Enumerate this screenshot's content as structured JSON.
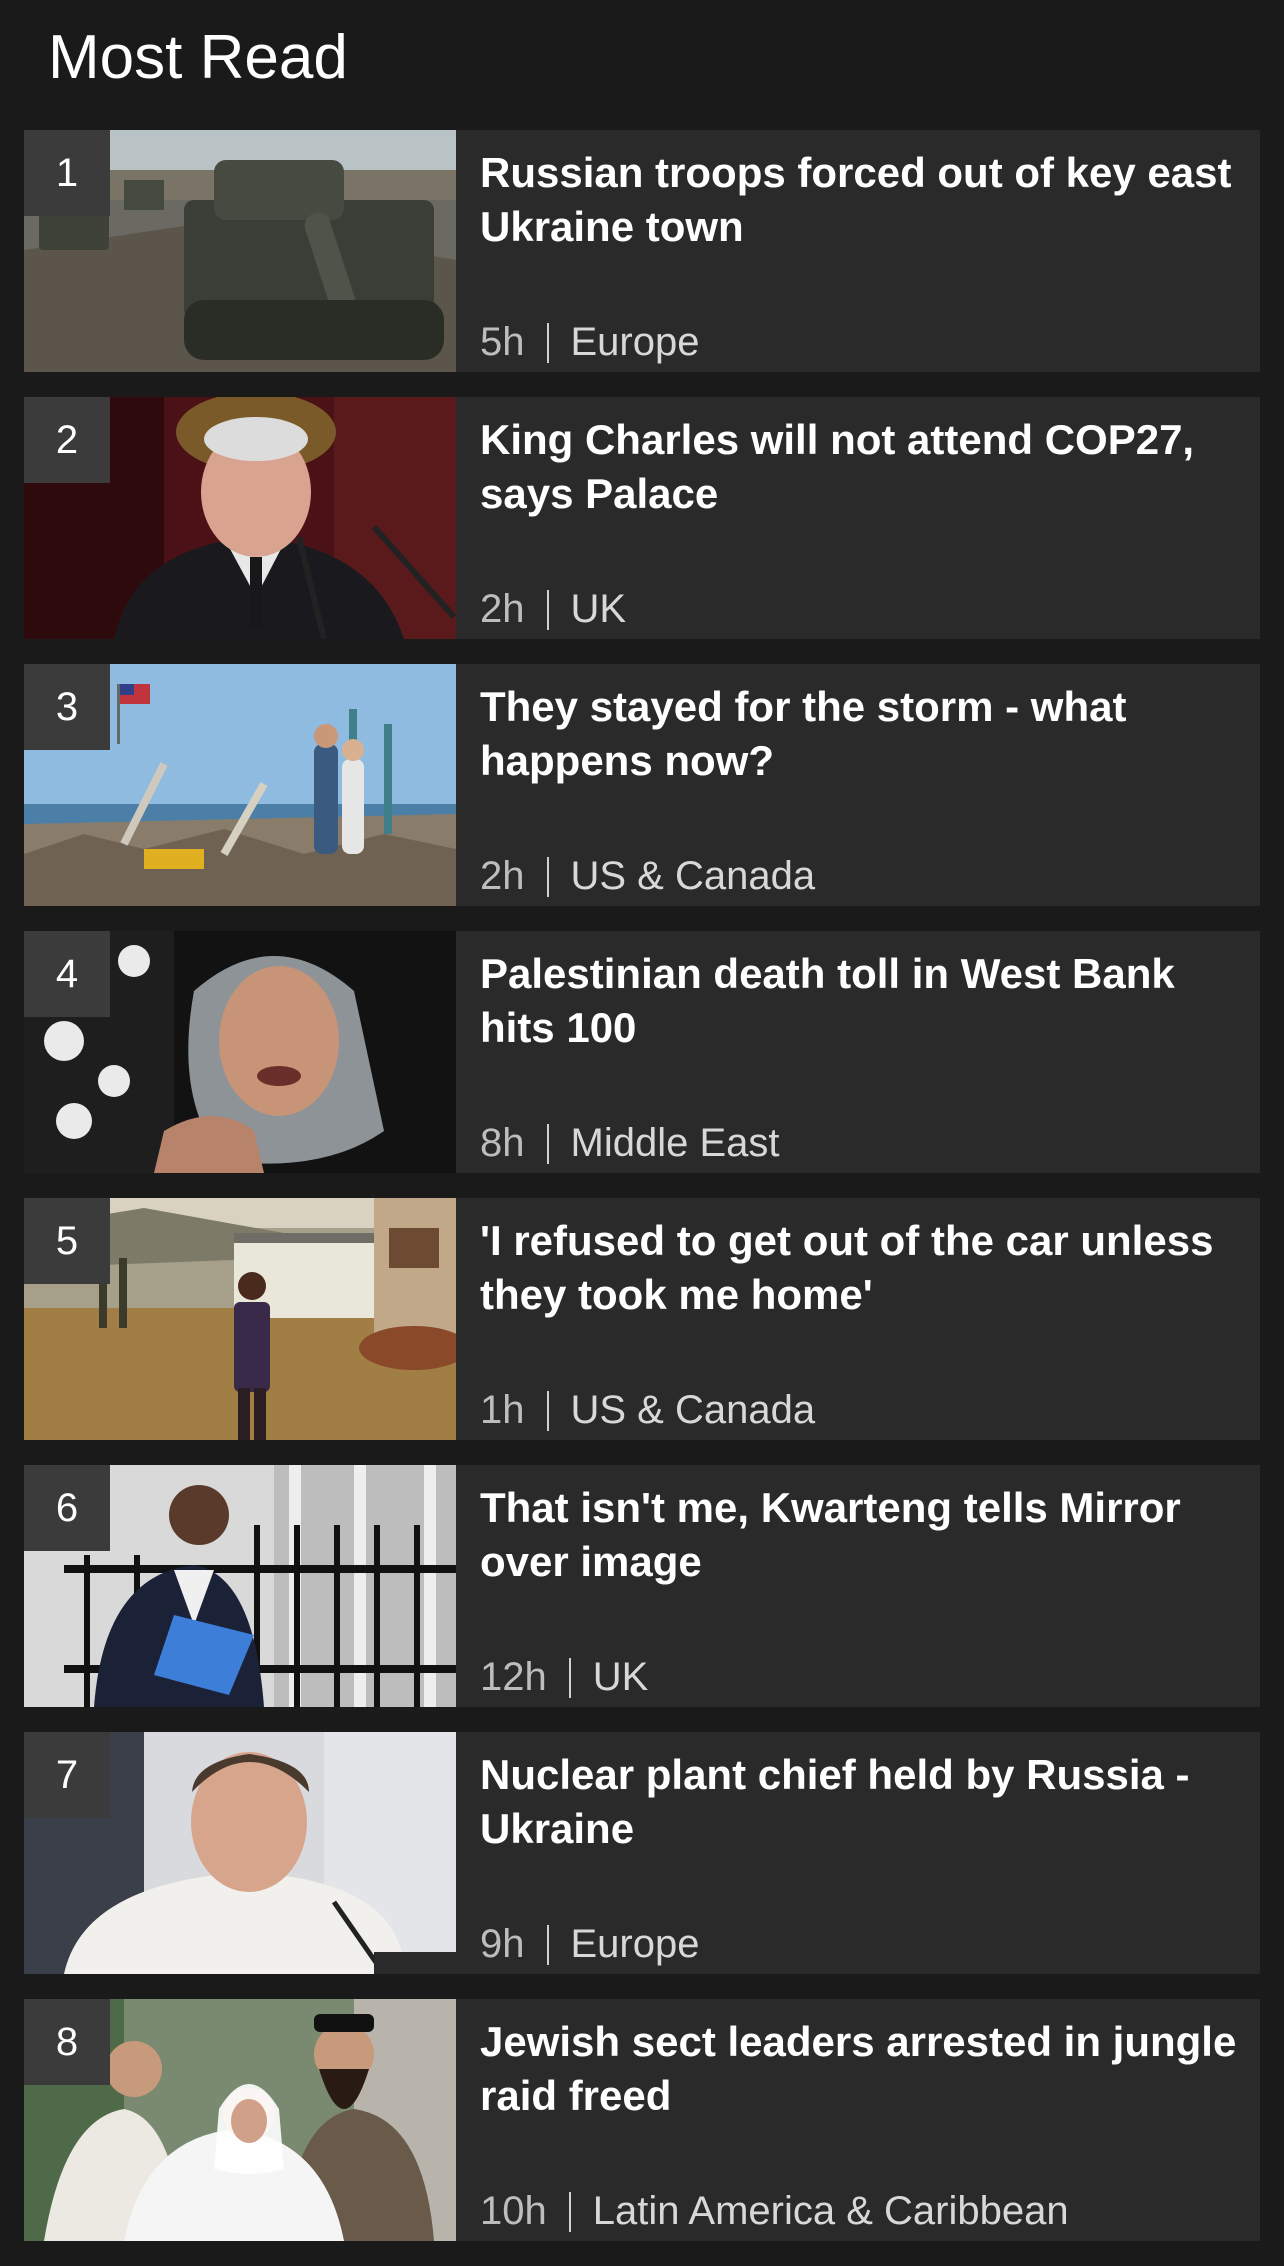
{
  "section": {
    "title": "Most Read"
  },
  "articles": [
    {
      "rank": "1",
      "headline": "Russian troops forced out of key east Ukraine town",
      "time": "5h",
      "category": "Europe",
      "image": "tank-on-road-photo"
    },
    {
      "rank": "2",
      "headline": "King Charles will not attend COP27, says Palace",
      "time": "2h",
      "category": "UK",
      "image": "king-speaking-photo"
    },
    {
      "rank": "3",
      "headline": "They stayed for the storm - what happens now?",
      "time": "2h",
      "category": "US & Canada",
      "image": "storm-debris-photo"
    },
    {
      "rank": "4",
      "headline": "Palestinian death toll in West Bank hits 100",
      "time": "8h",
      "category": "Middle East",
      "image": "grieving-woman-photo"
    },
    {
      "rank": "5",
      "headline": "'I refused to get out of the car unless they took me home'",
      "time": "1h",
      "category": "US & Canada",
      "image": "child-outside-house-photo"
    },
    {
      "rank": "6",
      "headline": "That isn't me, Kwarteng tells Mirror over image",
      "time": "12h",
      "category": "UK",
      "image": "man-with-folder-photo"
    },
    {
      "rank": "7",
      "headline": "Nuclear plant chief held by Russia - Ukraine",
      "time": "9h",
      "category": "Europe",
      "image": "man-at-microphone-photo"
    },
    {
      "rank": "8",
      "headline": "Jewish sect leaders arrested in jungle raid freed",
      "time": "10h",
      "category": "Latin America & Caribbean",
      "image": "group-of-people-photo"
    }
  ],
  "colors": {
    "background": "#1a1a1a",
    "card": "#2a2a2a",
    "rank_badge": "#3b3b3b",
    "headline": "#ffffff",
    "meta": "#d8d8d8"
  }
}
